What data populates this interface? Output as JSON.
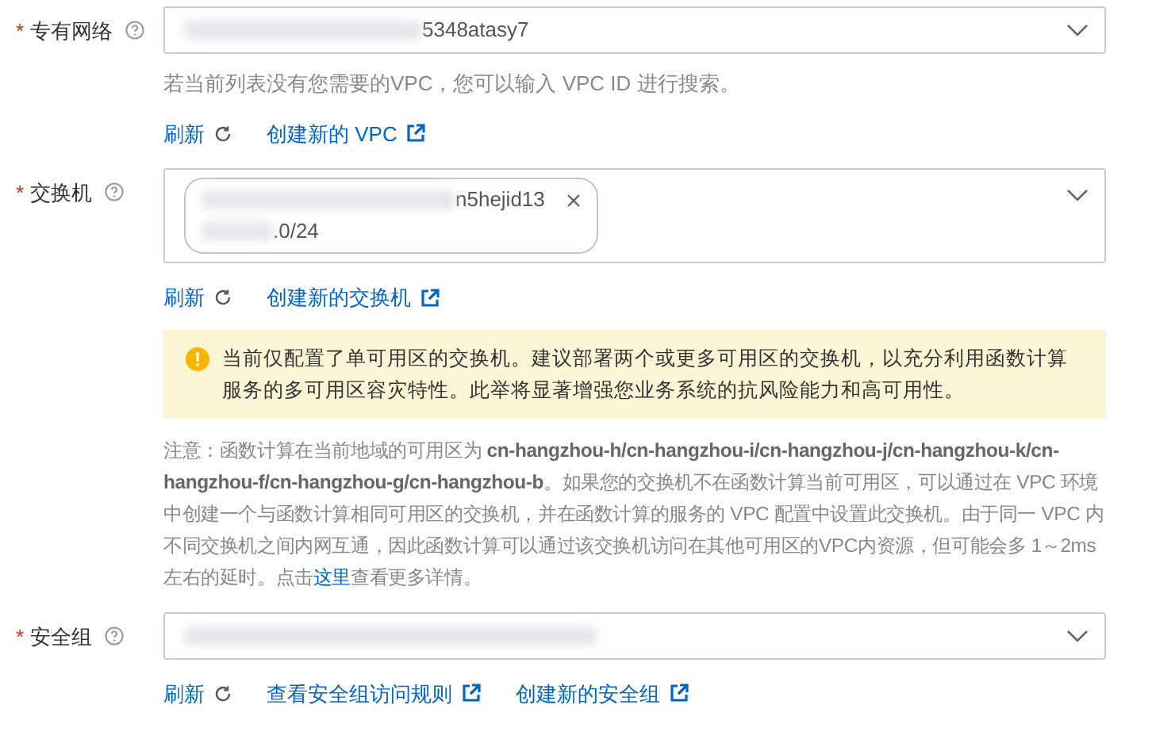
{
  "fields": [
    {
      "label": "专有网络",
      "required_mark": "*",
      "kind": "select",
      "value": "5348atasy7",
      "hint": "若当前列表没有您需要的VPC，您可以输入 VPC ID 进行搜索。",
      "links": [
        {
          "text": "刷新",
          "kind": "refresh"
        },
        {
          "text": "创建新的 VPC",
          "kind": "external"
        }
      ]
    },
    {
      "label": "交换机",
      "required_mark": "*",
      "kind": "tags",
      "tags": [
        {
          "line_1": "n5hejid13",
          "line_2": ".0/24"
        }
      ],
      "links": [
        {
          "text": "刷新",
          "kind": "refresh"
        },
        {
          "text": "创建新的交换机",
          "kind": "external"
        }
      ],
      "alert": "当前仅配置了单可用区的交换机。建议部署两个或更多可用区的交换机，以充分利用函数计算服务的多可用区容灾特性。此举将显著增强您业务系统的抗风险能力和高可用性。",
      "note": {
        "before": "注意：函数计算在当前地域的可用区为 **cn-hangzhou-h/cn-hangzhou-i/cn-hangzhou-j/cn-hangzhou-k/cn-hangzhou-f/cn-hangzhou-g/cn-hangzhou-b**。如果您的交换机不在函数计算当前可用区，可以通过在 VPC 环境中创建一个与函数计算相同可用区的交换机，并在函数计算的服务的 VPC 配置中设置此交换机。由于同一 VPC 内不同交换机之间内网互通，因此函数计算可以通过该交换机访问在其他可用区的VPC内资源，但可能会多 1～2ms 左右的延时。点击",
        "link": "这里",
        "after": "查看更多详情。"
      }
    },
    {
      "label": "安全组",
      "required_mark": "*",
      "kind": "select",
      "links": [
        {
          "text": "刷新",
          "kind": "refresh"
        },
        {
          "text": "查看安全组访问规则",
          "kind": "external"
        },
        {
          "text": "创建新的安全组",
          "kind": "external"
        }
      ]
    }
  ]
}
